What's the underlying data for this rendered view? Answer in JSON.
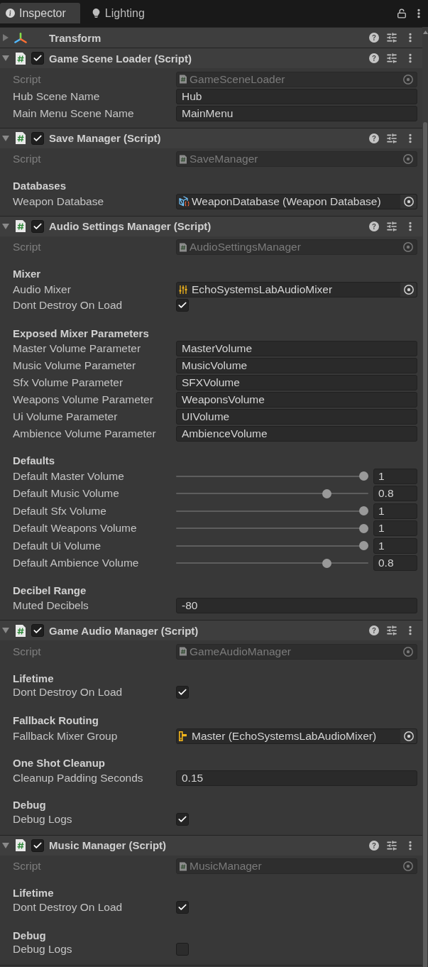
{
  "tabs": [
    {
      "label": "Inspector",
      "selected": true
    },
    {
      "label": "Lighting",
      "selected": false
    }
  ],
  "components": [
    {
      "kind": "transform",
      "title": "Transform",
      "expanded": false
    },
    {
      "kind": "script",
      "title": "Game Scene Loader (Script)",
      "expanded": true,
      "enabled": true,
      "rows": [
        {
          "kind": "script",
          "label": "Script",
          "value": "GameSceneLoader",
          "disabled": true
        },
        {
          "kind": "text",
          "label": "Hub Scene Name",
          "value": "Hub"
        },
        {
          "kind": "text",
          "label": "Main Menu Scene Name",
          "value": "MainMenu"
        }
      ]
    },
    {
      "kind": "script",
      "title": "Save Manager (Script)",
      "expanded": true,
      "enabled": true,
      "rows": [
        {
          "kind": "script",
          "label": "Script",
          "value": "SaveManager",
          "disabled": true
        },
        {
          "kind": "heading",
          "label": "Databases"
        },
        {
          "kind": "asset",
          "label": "Weapon Database",
          "value": "WeaponDatabase (Weapon Database)"
        }
      ]
    },
    {
      "kind": "script",
      "title": "Audio Settings Manager (Script)",
      "expanded": true,
      "enabled": true,
      "rows": [
        {
          "kind": "script",
          "label": "Script",
          "value": "AudioSettingsManager",
          "disabled": true
        },
        {
          "kind": "heading",
          "label": "Mixer"
        },
        {
          "kind": "mixer",
          "label": "Audio Mixer",
          "value": "EchoSystemsLabAudioMixer"
        },
        {
          "kind": "toggle",
          "label": "Dont Destroy On Load",
          "checked": true
        },
        {
          "kind": "heading",
          "label": "Exposed Mixer Parameters"
        },
        {
          "kind": "text",
          "label": "Master Volume Parameter",
          "value": "MasterVolume"
        },
        {
          "kind": "text",
          "label": "Music Volume Parameter",
          "value": "MusicVolume"
        },
        {
          "kind": "text",
          "label": "Sfx Volume Parameter",
          "value": "SFXVolume"
        },
        {
          "kind": "text",
          "label": "Weapons Volume Parameter",
          "value": "WeaponsVolume"
        },
        {
          "kind": "text",
          "label": "Ui Volume Parameter",
          "value": "UIVolume"
        },
        {
          "kind": "text",
          "label": "Ambience Volume Parameter",
          "value": "AmbienceVolume"
        },
        {
          "kind": "heading",
          "label": "Defaults"
        },
        {
          "kind": "slider",
          "label": "Default Master Volume",
          "level": 1,
          "value": "1"
        },
        {
          "kind": "slider",
          "label": "Default Music Volume",
          "level": 0.8,
          "value": "0.8"
        },
        {
          "kind": "slider",
          "label": "Default Sfx Volume",
          "level": 1,
          "value": "1"
        },
        {
          "kind": "slider",
          "label": "Default Weapons Volume",
          "level": 1,
          "value": "1"
        },
        {
          "kind": "slider",
          "label": "Default Ui Volume",
          "level": 1,
          "value": "1"
        },
        {
          "kind": "slider",
          "label": "Default Ambience Volume",
          "level": 0.8,
          "value": "0.8"
        },
        {
          "kind": "heading",
          "label": "Decibel Range"
        },
        {
          "kind": "text",
          "label": "Muted Decibels",
          "value": "-80"
        }
      ]
    },
    {
      "kind": "script",
      "title": "Game Audio Manager (Script)",
      "expanded": true,
      "enabled": true,
      "rows": [
        {
          "kind": "script",
          "label": "Script",
          "value": "GameAudioManager",
          "disabled": true
        },
        {
          "kind": "heading",
          "label": "Lifetime"
        },
        {
          "kind": "toggle",
          "label": "Dont Destroy On Load",
          "checked": true
        },
        {
          "kind": "heading",
          "label": "Fallback Routing"
        },
        {
          "kind": "mixer_group",
          "label": "Fallback Mixer Group",
          "value": "Master (EchoSystemsLabAudioMixer)"
        },
        {
          "kind": "heading",
          "label": "One Shot Cleanup"
        },
        {
          "kind": "text",
          "label": "Cleanup Padding Seconds",
          "value": "0.15"
        },
        {
          "kind": "heading",
          "label": "Debug"
        },
        {
          "kind": "toggle",
          "label": "Debug Logs",
          "checked": true
        }
      ]
    },
    {
      "kind": "script",
      "title": "Music Manager (Script)",
      "expanded": true,
      "enabled": true,
      "rows": [
        {
          "kind": "script",
          "label": "Script",
          "value": "MusicManager",
          "disabled": true
        },
        {
          "kind": "heading",
          "label": "Lifetime"
        },
        {
          "kind": "toggle",
          "label": "Dont Destroy On Load",
          "checked": true
        },
        {
          "kind": "heading",
          "label": "Debug"
        },
        {
          "kind": "toggle",
          "label": "Debug Logs",
          "checked": false
        }
      ]
    }
  ]
}
